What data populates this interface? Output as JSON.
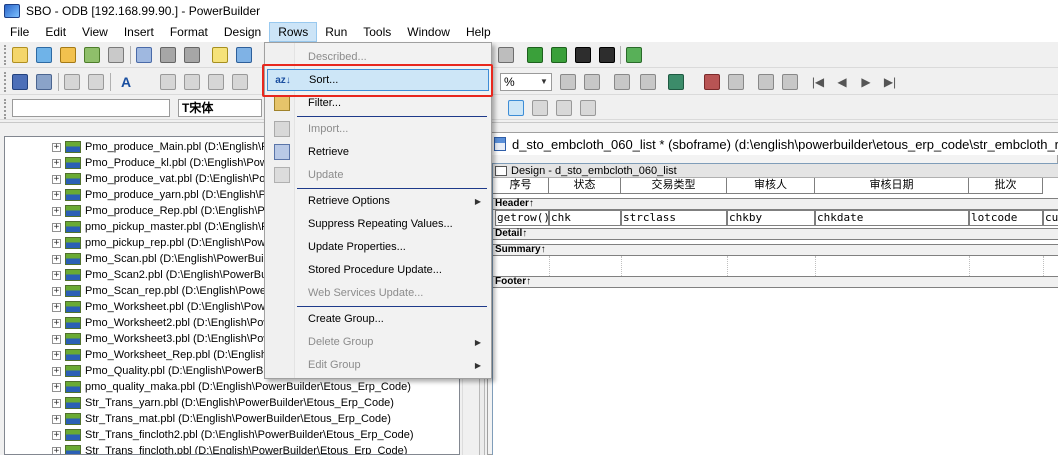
{
  "window": {
    "title": "SBO - ODB [192.168.99.90.] - PowerBuilder"
  },
  "menubar": {
    "items": [
      "File",
      "Edit",
      "View",
      "Insert",
      "Format",
      "Design",
      "Rows",
      "Run",
      "Tools",
      "Window",
      "Help"
    ],
    "active": "Rows"
  },
  "toolbar": {
    "font_name": "T宋体",
    "format_combo": "%"
  },
  "rows_menu": {
    "items": [
      {
        "label": "Described...",
        "disabled": true
      },
      {
        "label": "Sort...",
        "disabled": false,
        "highlight": true
      },
      {
        "label": "Filter...",
        "disabled": false
      },
      {
        "label": "Import...",
        "disabled": true
      },
      {
        "label": "Retrieve",
        "disabled": false
      },
      {
        "label": "Update",
        "disabled": true
      },
      {
        "label": "Retrieve Options",
        "disabled": false,
        "submenu": true
      },
      {
        "label": "Suppress Repeating Values...",
        "disabled": false
      },
      {
        "label": "Update Properties...",
        "disabled": false
      },
      {
        "label": "Stored Procedure Update...",
        "disabled": false
      },
      {
        "label": "Web Services Update...",
        "disabled": true
      },
      {
        "label": "Create Group...",
        "disabled": false
      },
      {
        "label": "Delete Group",
        "disabled": true,
        "submenu": true
      },
      {
        "label": "Edit Group",
        "disabled": true,
        "submenu": true
      }
    ]
  },
  "library_tree": {
    "items": [
      "Pmo_produce_Main.pbl (D:\\English\\Po",
      "Pmo_Produce_kl.pbl (D:\\English\\Powe",
      "Pmo_produce_vat.pbl (D:\\English\\Pow",
      "Pmo_produce_yarn.pbl (D:\\English\\Po",
      "Pmo_produce_Rep.pbl (D:\\English\\Pow",
      "pmo_pickup_master.pbl (D:\\English\\P",
      "pmo_pickup_rep.pbl (D:\\English\\Powe",
      "Pmo_Scan.pbl (D:\\English\\PowerBuild",
      "Pmo_Scan2.pbl (D:\\English\\PowerBuil",
      "Pmo_Scan_rep.pbl (D:\\English\\Powe",
      "Pmo_Worksheet.pbl (D:\\English\\Powe",
      "Pmo_Worksheet2.pbl (D:\\English\\Pow",
      "Pmo_Worksheet3.pbl (D:\\English\\Pow",
      "Pmo_Worksheet_Rep.pbl (D:\\English",
      "Pmo_Quality.pbl (D:\\English\\PowerBu",
      "pmo_quality_maka.pbl (D:\\English\\PowerBuilder\\Etous_Erp_Code)",
      "Str_Trans_yarn.pbl (D:\\English\\PowerBuilder\\Etous_Erp_Code)",
      "Str_Trans_mat.pbl (D:\\English\\PowerBuilder\\Etous_Erp_Code)",
      "Str_Trans_fincloth2.pbl (D:\\English\\PowerBuilder\\Etous_Erp_Code)",
      "Str_Trans_fincloth.pbl (D:\\English\\PowerBuilder\\Etous_Erp_Code)"
    ]
  },
  "datawindow": {
    "frame_title": "d_sto_embcloth_060_list * (sboframe) (d:\\english\\powerbuilder\\etous_erp_code\\str_embcloth_r",
    "design_caption": "Design - d_sto_embcloth_060_list",
    "headers": [
      "序号",
      "状态",
      "交易类型",
      "审核人",
      "审核日期",
      "批次"
    ],
    "columns": [
      "getrow()",
      "chk",
      "strclass",
      "chkby",
      "chkdate",
      "lotcode",
      "cus"
    ],
    "bands": {
      "header": "Header↑",
      "detail": "Detail↑",
      "summary": "Summary↑",
      "footer": "Footer↑"
    }
  }
}
